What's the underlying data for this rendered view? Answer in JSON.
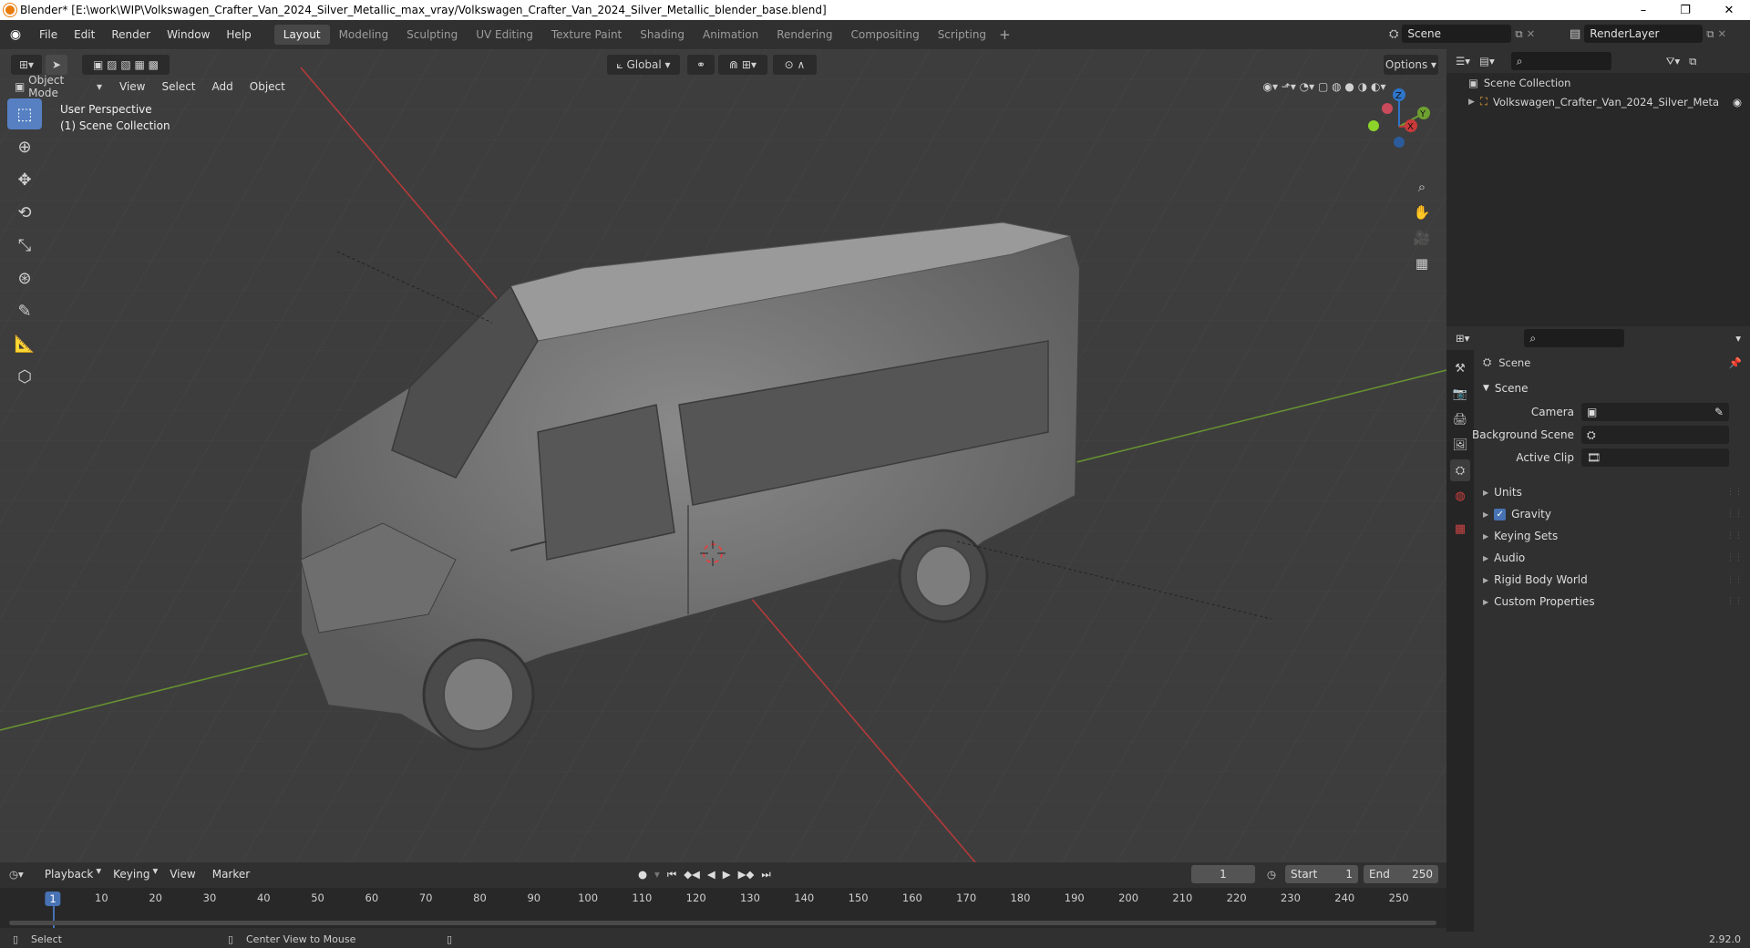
{
  "window": {
    "title": "Blender* [E:\\work\\WIP\\Volkswagen_Crafter_Van_2024_Silver_Metallic_max_vray/Volkswagen_Crafter_Van_2024_Silver_Metallic_blender_base.blend]",
    "minimize": "–",
    "maximize": "❐",
    "close": "✕"
  },
  "menu": [
    "File",
    "Edit",
    "Render",
    "Window",
    "Help"
  ],
  "workspaces": [
    "Layout",
    "Modeling",
    "Sculpting",
    "UV Editing",
    "Texture Paint",
    "Shading",
    "Animation",
    "Rendering",
    "Compositing",
    "Scripting"
  ],
  "add_workspace": "+",
  "scene_field": "Scene",
  "renderlayer_field": "RenderLayer",
  "viewport_header": {
    "mode": "Object Mode",
    "menus": [
      "View",
      "Select",
      "Add",
      "Object"
    ],
    "transform_orientation": "Global",
    "options": "Options"
  },
  "viewport_overlay_text": {
    "line1": "User Perspective",
    "line2": "(1) Scene Collection"
  },
  "gizmo": {
    "x": "X",
    "y": "Y",
    "z": "Z"
  },
  "outliner": {
    "root": "Scene Collection",
    "item": "Volkswagen_Crafter_Van_2024_Silver_Meta"
  },
  "properties": {
    "context": "Scene",
    "panel": "Scene",
    "camera_label": "Camera",
    "background_scene_label": "Background Scene",
    "active_clip_label": "Active Clip",
    "sections": [
      "Units",
      "Gravity",
      "Keying Sets",
      "Audio",
      "Rigid Body World",
      "Custom Properties"
    ],
    "gravity_checked": true
  },
  "timeline": {
    "menus": [
      "Playback",
      "Keying",
      "View",
      "Marker"
    ],
    "current_frame": "1",
    "start_label": "Start",
    "start": "1",
    "end_label": "End",
    "end": "250",
    "ruler": [
      "1",
      "10",
      "20",
      "30",
      "40",
      "50",
      "60",
      "70",
      "80",
      "90",
      "100",
      "110",
      "120",
      "130",
      "140",
      "150",
      "160",
      "170",
      "180",
      "190",
      "200",
      "210",
      "220",
      "230",
      "240",
      "250"
    ]
  },
  "statusbar": {
    "left": "Select",
    "middle": "Center View to Mouse",
    "version": "2.92.0"
  },
  "colors": {
    "accent": "#5680c2",
    "x_axis": "#c93a3a",
    "y_axis": "#6ea030",
    "z_axis": "#2e74c9",
    "active_frame": "#4772b3"
  }
}
